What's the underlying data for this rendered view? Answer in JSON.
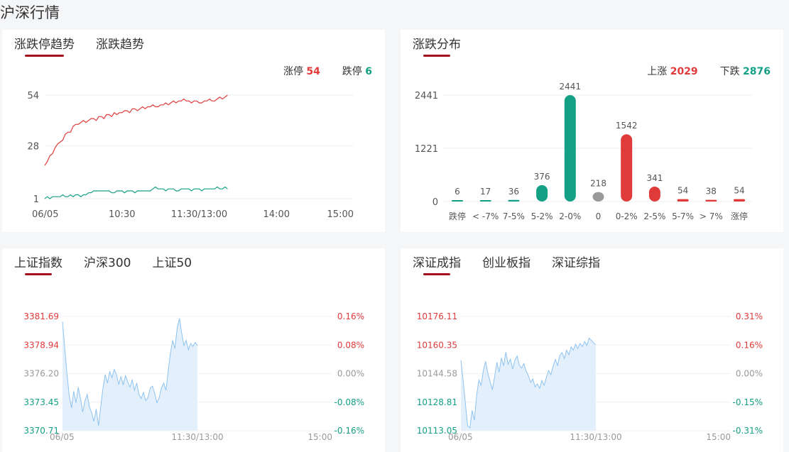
{
  "page_title": "沪深行情",
  "limit_panel": {
    "tabs": [
      "涨跌停趋势",
      "涨跌趋势"
    ],
    "active_tab": 0,
    "legend": {
      "up_label": "涨停",
      "up_value": "54",
      "down_label": "跌停",
      "down_value": "6"
    }
  },
  "dist_panel": {
    "tabs": [
      "涨跌分布"
    ],
    "active_tab": 0,
    "legend": {
      "up_label": "上涨",
      "up_value": "2029",
      "down_label": "下跌",
      "down_value": "2876"
    }
  },
  "index_panel_1": {
    "tabs": [
      "上证指数",
      "沪深300",
      "上证50"
    ],
    "active_tab": 0
  },
  "index_panel_2": {
    "tabs": [
      "深证成指",
      "创业板指",
      "深证综指"
    ],
    "active_tab": 0
  },
  "colors": {
    "up": "#e03a3a",
    "down": "#13a085",
    "flat": "#999999",
    "tab_underline": "#a40f1e",
    "area_fill": "#e3f0fc",
    "area_line": "#8fc3f0"
  },
  "chart_data": [
    {
      "type": "line",
      "id": "limit_trend",
      "x_ticks": [
        "06/05",
        "10:30",
        "11:30/13:00",
        "14:00",
        "15:00"
      ],
      "y_ticks": [
        1,
        28,
        54
      ],
      "ylim": [
        1,
        54
      ],
      "session_minutes": 240,
      "series": [
        {
          "name": "涨停",
          "color": "#e03a3a",
          "values": [
            [
              0,
              18
            ],
            [
              2,
              20
            ],
            [
              4,
              23
            ],
            [
              6,
              24
            ],
            [
              8,
              27
            ],
            [
              10,
              29
            ],
            [
              12,
              30
            ],
            [
              14,
              31
            ],
            [
              16,
              34
            ],
            [
              18,
              35
            ],
            [
              20,
              35
            ],
            [
              22,
              38
            ],
            [
              24,
              39
            ],
            [
              26,
              39
            ],
            [
              28,
              40
            ],
            [
              30,
              41
            ],
            [
              32,
              40
            ],
            [
              34,
              41
            ],
            [
              36,
              42
            ],
            [
              38,
              42
            ],
            [
              40,
              41
            ],
            [
              42,
              43
            ],
            [
              44,
              43
            ],
            [
              46,
              42
            ],
            [
              48,
              44
            ],
            [
              50,
              44
            ],
            [
              52,
              43
            ],
            [
              54,
              45
            ],
            [
              56,
              44
            ],
            [
              58,
              45
            ],
            [
              60,
              45
            ],
            [
              62,
              46
            ],
            [
              64,
              46
            ],
            [
              66,
              45
            ],
            [
              68,
              47
            ],
            [
              70,
              47
            ],
            [
              72,
              46
            ],
            [
              74,
              47
            ],
            [
              76,
              48
            ],
            [
              78,
              47
            ],
            [
              80,
              48
            ],
            [
              82,
              48
            ],
            [
              84,
              49
            ],
            [
              86,
              48
            ],
            [
              88,
              48
            ],
            [
              90,
              49
            ],
            [
              92,
              49
            ],
            [
              94,
              50
            ],
            [
              96,
              49
            ],
            [
              98,
              50
            ],
            [
              100,
              51
            ],
            [
              102,
              50
            ],
            [
              104,
              51
            ],
            [
              106,
              51
            ],
            [
              108,
              52
            ],
            [
              110,
              51
            ],
            [
              112,
              51
            ],
            [
              114,
              50
            ],
            [
              116,
              51
            ],
            [
              118,
              51
            ],
            [
              120,
              50
            ],
            [
              122,
              50
            ],
            [
              124,
              51
            ],
            [
              126,
              51
            ],
            [
              128,
              52
            ],
            [
              130,
              51
            ],
            [
              132,
              51
            ],
            [
              134,
              52
            ],
            [
              136,
              53
            ],
            [
              138,
              52
            ],
            [
              140,
              53
            ],
            [
              142,
              54
            ]
          ]
        },
        {
          "name": "跌停",
          "color": "#13a085",
          "values": [
            [
              0,
              1
            ],
            [
              2,
              2
            ],
            [
              4,
              1
            ],
            [
              6,
              2
            ],
            [
              8,
              2
            ],
            [
              10,
              2
            ],
            [
              12,
              2
            ],
            [
              14,
              3
            ],
            [
              16,
              2
            ],
            [
              18,
              2
            ],
            [
              20,
              3
            ],
            [
              22,
              2
            ],
            [
              24,
              3
            ],
            [
              26,
              3
            ],
            [
              28,
              2
            ],
            [
              30,
              3
            ],
            [
              32,
              3
            ],
            [
              34,
              4
            ],
            [
              36,
              4
            ],
            [
              38,
              5
            ],
            [
              40,
              5
            ],
            [
              42,
              5
            ],
            [
              44,
              5
            ],
            [
              46,
              5
            ],
            [
              48,
              5
            ],
            [
              50,
              5
            ],
            [
              52,
              4
            ],
            [
              54,
              4
            ],
            [
              56,
              5
            ],
            [
              58,
              5
            ],
            [
              60,
              5
            ],
            [
              62,
              4
            ],
            [
              64,
              5
            ],
            [
              66,
              5
            ],
            [
              68,
              5
            ],
            [
              70,
              4
            ],
            [
              72,
              5
            ],
            [
              74,
              5
            ],
            [
              76,
              5
            ],
            [
              78,
              5
            ],
            [
              80,
              5
            ],
            [
              82,
              5
            ],
            [
              84,
              6
            ],
            [
              86,
              7
            ],
            [
              88,
              6
            ],
            [
              90,
              6
            ],
            [
              92,
              6
            ],
            [
              94,
              5
            ],
            [
              96,
              6
            ],
            [
              98,
              6
            ],
            [
              100,
              6
            ],
            [
              102,
              5
            ],
            [
              104,
              5
            ],
            [
              106,
              6
            ],
            [
              108,
              6
            ],
            [
              110,
              6
            ],
            [
              112,
              6
            ],
            [
              114,
              5
            ],
            [
              116,
              6
            ],
            [
              118,
              6
            ],
            [
              120,
              6
            ],
            [
              122,
              5
            ],
            [
              124,
              6
            ],
            [
              126,
              6
            ],
            [
              128,
              6
            ],
            [
              130,
              6
            ],
            [
              132,
              6
            ],
            [
              134,
              7
            ],
            [
              136,
              6
            ],
            [
              138,
              6
            ],
            [
              140,
              7
            ],
            [
              142,
              6
            ]
          ]
        }
      ]
    },
    {
      "type": "bar",
      "id": "up_down_distribution",
      "categories": [
        "跌停",
        "< -7%",
        "7-5%",
        "5-2%",
        "2-0%",
        "0",
        "0-2%",
        "2-5%",
        "5-7%",
        "> 7%",
        "涨停"
      ],
      "values": [
        6,
        17,
        36,
        376,
        2441,
        218,
        1542,
        341,
        54,
        38,
        54
      ],
      "bar_colors": [
        "#13a085",
        "#13a085",
        "#13a085",
        "#13a085",
        "#13a085",
        "#999999",
        "#e03a3a",
        "#e03a3a",
        "#e03a3a",
        "#e03a3a",
        "#e03a3a"
      ],
      "y_ticks": [
        0,
        1221,
        2441
      ],
      "ylim": [
        0,
        2441
      ]
    },
    {
      "type": "area",
      "id": "sh_index",
      "x_ticks": [
        "06/05",
        "11:30/13:00",
        "15:00"
      ],
      "y_ticks_left": [
        "3381.69",
        "3378.94",
        "3376.20",
        "3373.45",
        "3370.71"
      ],
      "y_ticks_right": [
        "0.16%",
        "0.08%",
        "0.00%",
        "-0.08%",
        "-0.16%"
      ],
      "ylim": [
        3370.71,
        3381.69
      ],
      "session_minutes": 240,
      "values": [
        [
          0,
          3381.2
        ],
        [
          2,
          3378.6
        ],
        [
          4,
          3376.2
        ],
        [
          6,
          3374.1
        ],
        [
          8,
          3372.9
        ],
        [
          10,
          3374.5
        ],
        [
          12,
          3373.4
        ],
        [
          14,
          3374.9
        ],
        [
          16,
          3373.8
        ],
        [
          18,
          3372.5
        ],
        [
          20,
          3373.6
        ],
        [
          22,
          3374.2
        ],
        [
          24,
          3373.0
        ],
        [
          26,
          3372.4
        ],
        [
          28,
          3371.6
        ],
        [
          30,
          3372.8
        ],
        [
          32,
          3371.2
        ],
        [
          34,
          3373.0
        ],
        [
          36,
          3374.8
        ],
        [
          38,
          3376.1
        ],
        [
          40,
          3375.3
        ],
        [
          42,
          3376.4
        ],
        [
          44,
          3375.8
        ],
        [
          46,
          3376.6
        ],
        [
          48,
          3376.1
        ],
        [
          50,
          3375.2
        ],
        [
          52,
          3375.9
        ],
        [
          54,
          3375.1
        ],
        [
          56,
          3376.0
        ],
        [
          58,
          3375.4
        ],
        [
          60,
          3374.9
        ],
        [
          62,
          3375.6
        ],
        [
          64,
          3374.6
        ],
        [
          66,
          3375.3
        ],
        [
          68,
          3374.2
        ],
        [
          70,
          3373.8
        ],
        [
          72,
          3374.4
        ],
        [
          74,
          3373.6
        ],
        [
          76,
          3373.9
        ],
        [
          78,
          3374.8
        ],
        [
          80,
          3375.0
        ],
        [
          82,
          3374.3
        ],
        [
          84,
          3373.4
        ],
        [
          86,
          3373.9
        ],
        [
          88,
          3374.8
        ],
        [
          90,
          3375.3
        ],
        [
          92,
          3374.6
        ],
        [
          94,
          3376.4
        ],
        [
          96,
          3378.2
        ],
        [
          98,
          3379.4
        ],
        [
          100,
          3378.6
        ],
        [
          102,
          3380.6
        ],
        [
          104,
          3381.5
        ],
        [
          106,
          3380.1
        ],
        [
          108,
          3378.9
        ],
        [
          110,
          3379.4
        ],
        [
          112,
          3378.5
        ],
        [
          114,
          3379.1
        ],
        [
          116,
          3378.8
        ],
        [
          118,
          3379.2
        ],
        [
          120,
          3378.9
        ]
      ]
    },
    {
      "type": "area",
      "id": "sz_component",
      "x_ticks": [
        "06/05",
        "11:30/13:00",
        "15:00"
      ],
      "y_ticks_left": [
        "10176.11",
        "10160.35",
        "10144.58",
        "10128.81",
        "10113.05"
      ],
      "y_ticks_right": [
        "0.31%",
        "0.16%",
        "0.00%",
        "-0.15%",
        "-0.31%"
      ],
      "ylim": [
        10113.05,
        10176.11
      ],
      "session_minutes": 240,
      "values": [
        [
          0,
          10152.0
        ],
        [
          2,
          10140.5
        ],
        [
          4,
          10128.2
        ],
        [
          6,
          10115.8
        ],
        [
          8,
          10114.6
        ],
        [
          10,
          10124.3
        ],
        [
          12,
          10118.9
        ],
        [
          14,
          10132.6
        ],
        [
          16,
          10141.0
        ],
        [
          18,
          10138.2
        ],
        [
          20,
          10146.5
        ],
        [
          22,
          10151.3
        ],
        [
          24,
          10144.7
        ],
        [
          26,
          10140.1
        ],
        [
          28,
          10135.6
        ],
        [
          30,
          10142.9
        ],
        [
          32,
          10150.8
        ],
        [
          34,
          10145.3
        ],
        [
          36,
          10153.2
        ],
        [
          38,
          10148.9
        ],
        [
          40,
          10156.4
        ],
        [
          42,
          10149.8
        ],
        [
          44,
          10152.6
        ],
        [
          46,
          10147.1
        ],
        [
          48,
          10151.9
        ],
        [
          50,
          10154.3
        ],
        [
          52,
          10149.2
        ],
        [
          54,
          10147.6
        ],
        [
          56,
          10150.1
        ],
        [
          58,
          10146.0
        ],
        [
          60,
          10143.5
        ],
        [
          62,
          10139.8
        ],
        [
          64,
          10141.6
        ],
        [
          66,
          10137.2
        ],
        [
          68,
          10138.9
        ],
        [
          70,
          10136.4
        ],
        [
          72,
          10140.7
        ],
        [
          74,
          10138.1
        ],
        [
          76,
          10142.5
        ],
        [
          78,
          10146.3
        ],
        [
          80,
          10144.0
        ],
        [
          82,
          10148.6
        ],
        [
          84,
          10152.4
        ],
        [
          86,
          10149.1
        ],
        [
          88,
          10154.7
        ],
        [
          90,
          10156.2
        ],
        [
          92,
          10152.9
        ],
        [
          94,
          10157.5
        ],
        [
          96,
          10155.0
        ],
        [
          98,
          10159.3
        ],
        [
          100,
          10157.6
        ],
        [
          102,
          10160.8
        ],
        [
          104,
          10158.4
        ],
        [
          106,
          10161.2
        ],
        [
          108,
          10159.5
        ],
        [
          110,
          10162.3
        ],
        [
          112,
          10160.1
        ],
        [
          114,
          10164.2
        ],
        [
          116,
          10163.0
        ],
        [
          118,
          10161.5
        ],
        [
          120,
          10160.4
        ]
      ]
    }
  ]
}
